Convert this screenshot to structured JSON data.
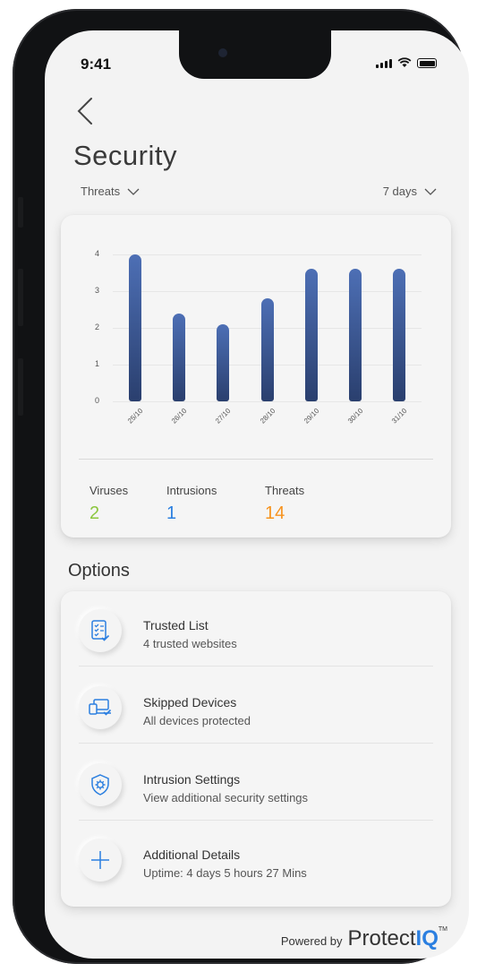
{
  "status": {
    "time": "9:41"
  },
  "page": {
    "title": "Security"
  },
  "filters": {
    "metric": "Threats",
    "range": "7 days"
  },
  "chart_data": {
    "type": "bar",
    "categories": [
      "25/10",
      "26/10",
      "27/10",
      "28/10",
      "29/10",
      "30/10",
      "31/10"
    ],
    "values": [
      4.0,
      2.4,
      2.1,
      2.8,
      3.6,
      3.6,
      3.6
    ],
    "yticks": [
      "4",
      "3",
      "2",
      "1",
      "0"
    ],
    "ylim": [
      0,
      4
    ],
    "title": "",
    "xlabel": "",
    "ylabel": "",
    "bar_color": "#2f4a85"
  },
  "stats": [
    {
      "label": "Viruses",
      "value": "2",
      "color": "#8cc63f"
    },
    {
      "label": "Intrusions",
      "value": "1",
      "color": "#2b7fe0"
    },
    {
      "label": "Threats",
      "value": "14",
      "color": "#f7931e"
    }
  ],
  "options": {
    "title": "Options",
    "items": [
      {
        "icon": "checklist-icon",
        "title": "Trusted List",
        "subtitle": "4 trusted websites"
      },
      {
        "icon": "devices-icon",
        "title": "Skipped Devices",
        "subtitle": "All devices protected"
      },
      {
        "icon": "shield-gear-icon",
        "title": "Intrusion Settings",
        "subtitle": "View additional security settings"
      },
      {
        "icon": "plus-icon",
        "title": "Additional Details",
        "subtitle": "Uptime: 4 days 5 hours 27 Mins"
      }
    ]
  },
  "footer": {
    "powered_by": "Powered by",
    "brand_a": "Protect",
    "brand_b": "IQ",
    "tm": "TM"
  },
  "colors": {
    "accent": "#2b7fe0",
    "screen_bg": "#f3f3f3"
  }
}
